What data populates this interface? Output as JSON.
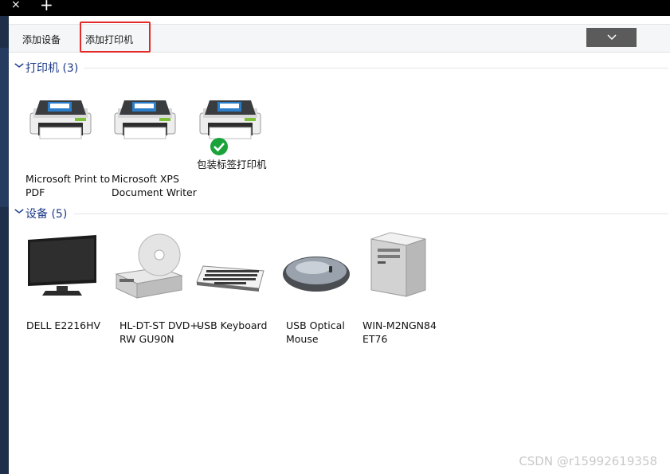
{
  "window_tab": {
    "close_glyph": "×",
    "new_tab_glyph": "+"
  },
  "toolbar": {
    "add_device_label": "添加设备",
    "add_printer_label": "添加打印机",
    "dropdown_glyph": "⌄"
  },
  "groups": {
    "printers": {
      "title": "打印机 (3)",
      "items": [
        {
          "label": "Microsoft Print to PDF"
        },
        {
          "label": "Microsoft XPS Document Writer"
        },
        {
          "label": "包装标签打印机",
          "default": true
        }
      ]
    },
    "devices": {
      "title": "设备 (5)",
      "items": [
        {
          "label": "DELL E2216HV",
          "icon": "monitor-icon"
        },
        {
          "label": "HL-DT-ST DVD+-RW GU90N",
          "icon": "dvd-drive-icon"
        },
        {
          "label": "USB Keyboard",
          "icon": "keyboard-icon"
        },
        {
          "label": "USB Optical Mouse",
          "icon": "mouse-icon"
        },
        {
          "label": "WIN-M2NGN84 ET76",
          "icon": "computer-tower-icon"
        }
      ]
    }
  },
  "watermark": "CSDN @r15992619358",
  "colors": {
    "accent": "#1e3b8a",
    "highlight_border": "#e22a2a",
    "check_green": "#1aa33a"
  }
}
